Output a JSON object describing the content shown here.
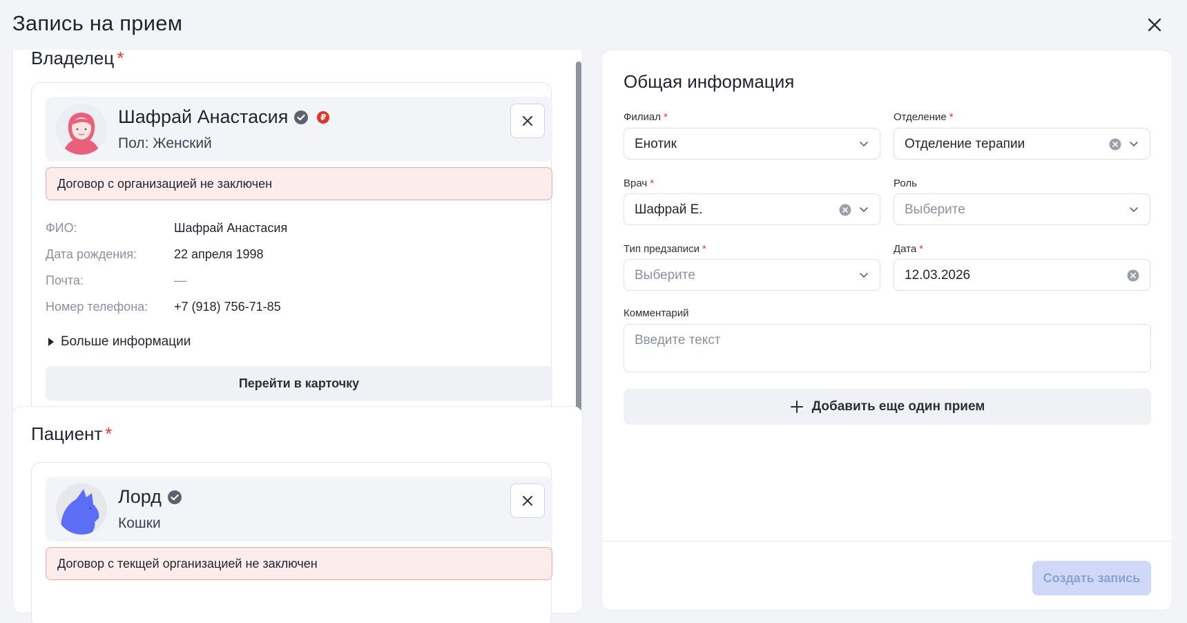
{
  "modal": {
    "title": "Запись на прием"
  },
  "owner": {
    "section_title": "Владелец",
    "required_mark": "*",
    "name": "Шафрай Анастасия",
    "sub": "Пол: Женский",
    "badge_symbol": "₽",
    "warning": "Договор с организацией не заключен",
    "info": [
      {
        "label": "ФИО:",
        "value": "Шафрай Анастасия"
      },
      {
        "label": "Дата рождения:",
        "value": "22 апреля 1998"
      },
      {
        "label": "Почта:",
        "value": "—"
      },
      {
        "label": "Номер телефона:",
        "value": "+7 (918) 756-71-85"
      }
    ],
    "more_label": "Больше информации",
    "go_card_label": "Перейти в карточку"
  },
  "patient": {
    "section_title": "Пациент",
    "required_mark": "*",
    "name": "Лорд",
    "sub": "Кошки",
    "warning": "Договор с текщей организацией не заключен"
  },
  "general": {
    "title": "Общая информация",
    "fields": {
      "branch": {
        "label": "Филиал",
        "value": "Енотик"
      },
      "department": {
        "label": "Отделение",
        "value": "Отделение терапии"
      },
      "doctor": {
        "label": "Врач",
        "value": "Шафрай Е."
      },
      "role": {
        "label": "Роль",
        "placeholder": "Выберите"
      },
      "pre_type": {
        "label": "Тип предзаписи",
        "placeholder": "Выберите"
      },
      "date": {
        "label": "Дата",
        "value": "12.03.2026"
      },
      "comment": {
        "label": "Комментарий",
        "placeholder": "Введите текст"
      }
    },
    "required_mark": "*",
    "add_label": "Добавить еще один прием",
    "create_label": "Создать запись"
  },
  "colors": {
    "required": "#e53935",
    "warning_bg": "#fdecec",
    "warning_border": "#f1a9a5",
    "primary_disabled": "#cfd9f7",
    "owner_avatar": "#e8607c",
    "patient_avatar": "#5b6ef5"
  },
  "icons": [
    "close-icon",
    "verified-icon",
    "ruble-badge-icon",
    "chevron-down-icon",
    "clear-icon",
    "plus-icon",
    "caret-right-icon"
  ]
}
